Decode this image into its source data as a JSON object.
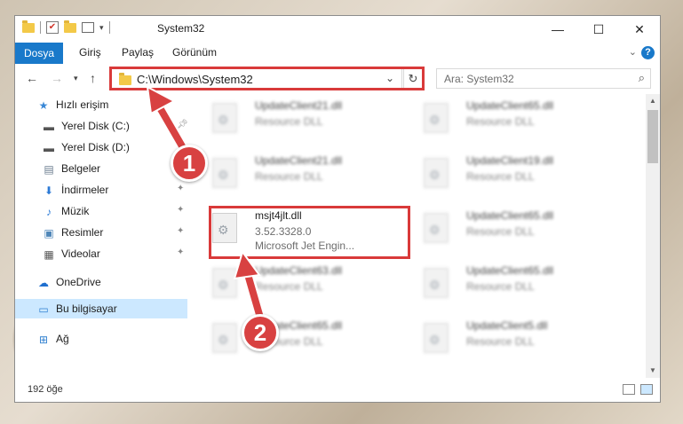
{
  "window": {
    "title": "System32",
    "controls": {
      "minimize": "—",
      "maximize": "☐",
      "close": "✕"
    }
  },
  "ribbon": {
    "tabs": [
      "Dosya",
      "Giriş",
      "Paylaş",
      "Görünüm"
    ],
    "help": "?"
  },
  "nav": {
    "address": "C:\\Windows\\System32",
    "search_placeholder": "Ara: System32"
  },
  "sidebar": {
    "items": [
      {
        "label": "Hızlı erişim",
        "icon": "star-icon",
        "glyph": "★",
        "color": "#3a88d6"
      },
      {
        "label": "Yerel Disk (C:)",
        "icon": "drive-icon",
        "glyph": "▬",
        "color": "#555555"
      },
      {
        "label": "Yerel Disk (D:)",
        "icon": "drive-icon",
        "glyph": "▬",
        "color": "#555555"
      },
      {
        "label": "Belgeler",
        "icon": "documents-icon",
        "glyph": "▤",
        "color": "#6b7d8f"
      },
      {
        "label": "İndirmeler",
        "icon": "download-icon",
        "glyph": "⬇",
        "color": "#2c7ad6"
      },
      {
        "label": "Müzik",
        "icon": "music-icon",
        "glyph": "♪",
        "color": "#2c7ad6"
      },
      {
        "label": "Resimler",
        "icon": "pictures-icon",
        "glyph": "▣",
        "color": "#4f86b8"
      },
      {
        "label": "Videolar",
        "icon": "videos-icon",
        "glyph": "▦",
        "color": "#555555"
      },
      {
        "label": "OneDrive",
        "icon": "cloud-icon",
        "glyph": "☁",
        "color": "#1f6fcf"
      },
      {
        "label": "Bu bilgisayar",
        "icon": "computer-icon",
        "glyph": "▭",
        "color": "#2f7fd0"
      },
      {
        "label": "Ağ",
        "icon": "network-icon",
        "glyph": "⊞",
        "color": "#2f7fd0"
      }
    ]
  },
  "files": [
    {
      "name": "UpdateClient21.dll",
      "line1": "Resource DLL",
      "line2": ""
    },
    {
      "name": "UpdateClient65.dll",
      "line1": "Resource DLL",
      "line2": ""
    },
    {
      "name": "UpdateClient21.dll",
      "line1": "Resource DLL",
      "line2": ""
    },
    {
      "name": "UpdateClient19.dll",
      "line1": "Resource DLL",
      "line2": ""
    },
    {
      "name": "msjt4jlt.dll",
      "line1": "3.52.3328.0",
      "line2": "Microsoft Jet Engin..."
    },
    {
      "name": "UpdateClient65.dll",
      "line1": "Resource DLL",
      "line2": ""
    },
    {
      "name": "UpdateClient63.dll",
      "line1": "Resource DLL",
      "line2": ""
    },
    {
      "name": "UpdateClient65.dll",
      "line1": "Resource DLL",
      "line2": ""
    },
    {
      "name": "UpdateClient65.dll",
      "line1": "Resource DLL",
      "line2": ""
    },
    {
      "name": "UpdateClient5.dll",
      "line1": "Resource DLL",
      "line2": ""
    }
  ],
  "status": {
    "count": "192 öğe"
  },
  "callouts": [
    "1",
    "2"
  ],
  "colors": {
    "accent": "#1979ca",
    "highlight": "#d93a3a",
    "selection": "#cce8ff"
  }
}
